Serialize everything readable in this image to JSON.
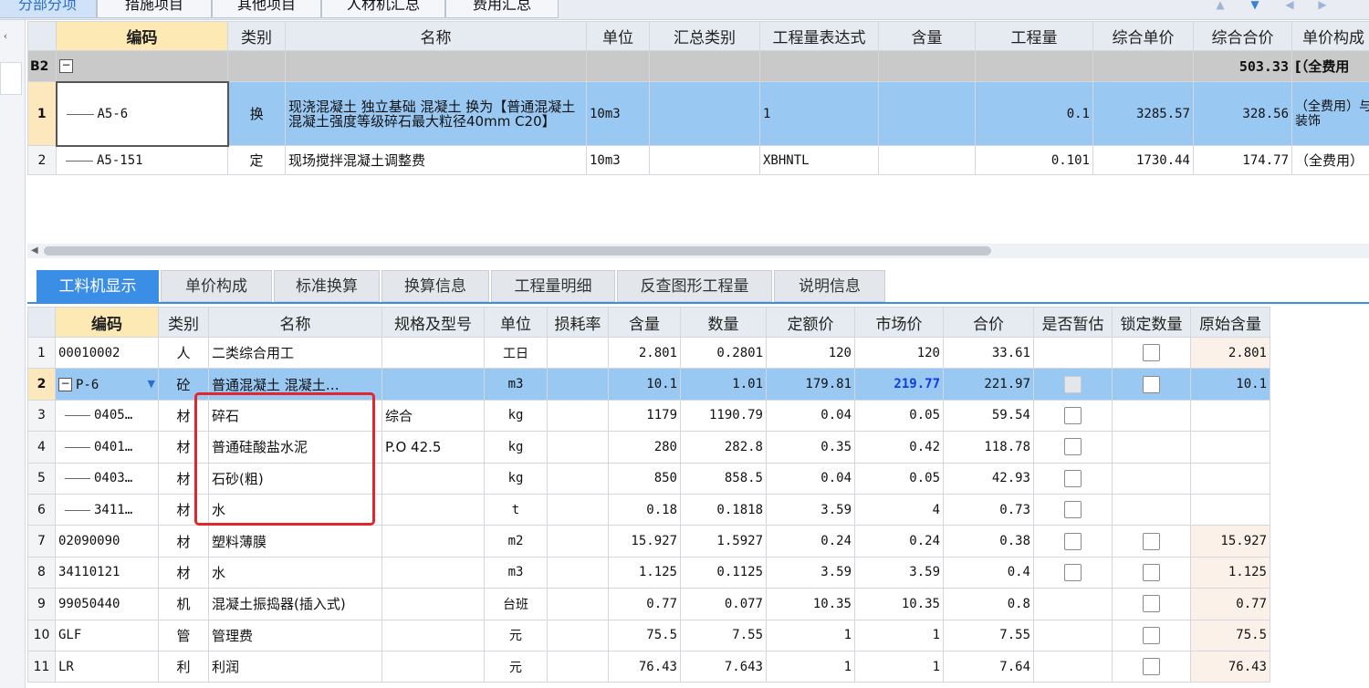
{
  "top_tabs": [
    "分部分项",
    "措施项目",
    "其他项目",
    "人材机汇总",
    "费用汇总"
  ],
  "upper_table": {
    "headers": [
      "编码",
      "类别",
      "名称",
      "单位",
      "汇总类别",
      "工程量表达式",
      "含量",
      "工程量",
      "综合单价",
      "综合合价",
      "单价构成"
    ],
    "group_row": {
      "code": "B2",
      "expand": "−",
      "total": "503.33",
      "suffix": "[（全费用"
    },
    "rows": [
      {
        "no": "1",
        "code": "A5-6",
        "type": "换",
        "name": "现浇混凝土 独立基础 混凝土    换为【普通混凝土 混凝土强度等级碎石最大粒径40mm C20】",
        "unit": "10m3",
        "summary": "",
        "expr": "1",
        "content": "",
        "qty": "0.1",
        "unit_price": "3285.57",
        "total": "328.56",
        "composition": "（全费用）与装饰"
      },
      {
        "no": "2",
        "code": "A5-151",
        "type": "定",
        "name": "现场搅拌混凝土调整费",
        "unit": "10m3",
        "summary": "",
        "expr": "XBHNTL",
        "content": "",
        "qty": "0.101",
        "unit_price": "1730.44",
        "total": "174.77",
        "composition": "（全费用）"
      }
    ]
  },
  "bottom_tabs": [
    "工料机显示",
    "单价构成",
    "标准换算",
    "换算信息",
    "工程量明细",
    "反查图形工程量",
    "说明信息"
  ],
  "lower_table": {
    "headers": [
      "编码",
      "类别",
      "名称",
      "规格及型号",
      "单位",
      "损耗率",
      "含量",
      "数量",
      "定额价",
      "市场价",
      "合价",
      "是否暂估",
      "锁定数量",
      "原始含量"
    ],
    "rows": [
      {
        "no": "1",
        "code": "00010002",
        "type": "人",
        "name": "二类综合用工",
        "spec": "",
        "unit": "工日",
        "loss": "",
        "content": "2.801",
        "qty": "0.2801",
        "quota": "120",
        "market": "120",
        "total": "33.61",
        "est": "none",
        "lock": "box",
        "orig": "2.801"
      },
      {
        "no": "2",
        "code": "P-6",
        "type": "砼",
        "name": "普通混凝土 混凝土…",
        "spec": "",
        "unit": "m3",
        "loss": "",
        "content": "10.1",
        "qty": "1.01",
        "quota": "179.81",
        "market": "219.77",
        "total": "221.97",
        "est": "disabled",
        "lock": "box",
        "orig": "10.1"
      },
      {
        "no": "3",
        "code": "0405…",
        "type": "材",
        "name": "碎石",
        "spec": "综合",
        "unit": "kg",
        "loss": "",
        "content": "1179",
        "qty": "1190.79",
        "quota": "0.04",
        "market": "0.05",
        "total": "59.54",
        "est": "box",
        "lock": "none",
        "orig": ""
      },
      {
        "no": "4",
        "code": "0401…",
        "type": "材",
        "name": "普通硅酸盐水泥",
        "spec": "P.O 42.5",
        "unit": "kg",
        "loss": "",
        "content": "280",
        "qty": "282.8",
        "quota": "0.35",
        "market": "0.42",
        "total": "118.78",
        "est": "box",
        "lock": "none",
        "orig": ""
      },
      {
        "no": "5",
        "code": "0403…",
        "type": "材",
        "name": "石砂(粗)",
        "spec": "",
        "unit": "kg",
        "loss": "",
        "content": "850",
        "qty": "858.5",
        "quota": "0.04",
        "market": "0.05",
        "total": "42.93",
        "est": "box",
        "lock": "none",
        "orig": ""
      },
      {
        "no": "6",
        "code": "3411…",
        "type": "材",
        "name": "水",
        "spec": "",
        "unit": "t",
        "loss": "",
        "content": "0.18",
        "qty": "0.1818",
        "quota": "3.59",
        "market": "4",
        "total": "0.73",
        "est": "box",
        "lock": "none",
        "orig": ""
      },
      {
        "no": "7",
        "code": "02090090",
        "type": "材",
        "name": "塑料薄膜",
        "spec": "",
        "unit": "m2",
        "loss": "",
        "content": "15.927",
        "qty": "1.5927",
        "quota": "0.24",
        "market": "0.24",
        "total": "0.38",
        "est": "box",
        "lock": "box",
        "orig": "15.927"
      },
      {
        "no": "8",
        "code": "34110121",
        "type": "材",
        "name": "水",
        "spec": "",
        "unit": "m3",
        "loss": "",
        "content": "1.125",
        "qty": "0.1125",
        "quota": "3.59",
        "market": "3.59",
        "total": "0.4",
        "est": "box",
        "lock": "box",
        "orig": "1.125"
      },
      {
        "no": "9",
        "code": "99050440",
        "type": "机",
        "name": "混凝土振捣器(插入式)",
        "spec": "",
        "unit": "台班",
        "loss": "",
        "content": "0.77",
        "qty": "0.077",
        "quota": "10.35",
        "market": "10.35",
        "total": "0.8",
        "est": "none",
        "lock": "box",
        "orig": "0.77"
      },
      {
        "no": "10",
        "code": "GLF",
        "type": "管",
        "name": "管理费",
        "spec": "",
        "unit": "元",
        "loss": "",
        "content": "75.5",
        "qty": "7.55",
        "quota": "1",
        "market": "1",
        "total": "7.55",
        "est": "none",
        "lock": "box",
        "orig": "75.5"
      },
      {
        "no": "11",
        "code": "LR",
        "type": "利",
        "name": "利润",
        "spec": "",
        "unit": "元",
        "loss": "",
        "content": "76.43",
        "qty": "7.643",
        "quota": "1",
        "market": "1",
        "total": "7.64",
        "est": "none",
        "lock": "box",
        "orig": "76.43"
      }
    ]
  },
  "colors": {
    "selected_row": "#99c8f3",
    "active_tab": "#3b8ee6",
    "highlight_border": "#e3262b",
    "market_price_emphasis": "#0b3de3"
  },
  "icons": {
    "upper_expand": "minus-box-icon",
    "p6_expand": "minus-box-icon",
    "dropdown": "chevron-down-icon"
  }
}
